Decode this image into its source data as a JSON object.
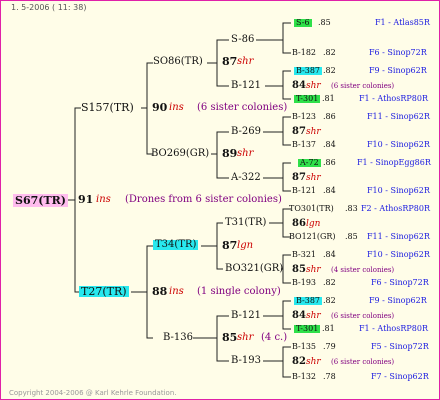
{
  "header": "1. 5-2006 ( 11: 38)",
  "footer": "Copyright 2004-2006 @ Karl Kehrle Foundation.",
  "root": {
    "id": "S67(TR)",
    "num": "91",
    "sym": "ins",
    "note": "(Drones from 6 sister colonies)"
  },
  "gen1": [
    {
      "id": "S157(TR)"
    },
    {
      "id": "T27(TR)"
    }
  ],
  "gen2": {
    "a": {
      "num": "90",
      "sym": "ins",
      "note": "(6 sister colonies)"
    },
    "b": {
      "num": "88",
      "sym": "ins",
      "note": "(1 single colony)"
    }
  },
  "gen3": [
    {
      "id": "SO86(TR)",
      "num": "87",
      "sym": "shr"
    },
    {
      "id": "BO269(GR)",
      "num": "89",
      "sym": "shr"
    },
    {
      "id": "T34(TR)",
      "num": "87",
      "sym": "lgn"
    },
    {
      "id": "B-136",
      "num": "85",
      "sym": "shr",
      "note": "(4 c.)"
    }
  ],
  "gen4": [
    {
      "id": "S-86",
      "num": "84",
      "sym": "shr",
      "note": "(6 sister colonies)"
    },
    {
      "id": "B-121"
    },
    {
      "id": "B-269",
      "num": "87",
      "sym": "shr"
    },
    {
      "id": "A-322"
    },
    {
      "id": "T31(TR)",
      "num": "86",
      "sym": "lgn"
    },
    {
      "id": "BO321(GR)",
      "num": "85",
      "sym": "shr",
      "note": "(4 sister colonies)"
    },
    {
      "id": "B-121",
      "num": "84",
      "sym": "shr",
      "note": "(6 sister colonies)"
    },
    {
      "id": "B-193",
      "num": "82",
      "sym": "shr",
      "note": "(6 sister colonies)"
    }
  ],
  "gen5": [
    {
      "id": "S-6",
      "val": ".85",
      "src": "F1 - Atlas85R"
    },
    {
      "id": "B-182",
      "val": ".82",
      "src": "F6 - Sinop72R"
    },
    {
      "id": "B-387",
      "val": ".82",
      "src": "F9 - Sinop62R"
    },
    {
      "id": "T-301",
      "val": ".81",
      "src": "F1 - AthosRP80R"
    },
    {
      "id": "B-123",
      "val": ".86",
      "src": "F11 - Sinop62R"
    },
    {
      "id": "B-137",
      "val": ".84",
      "src": "F10 - Sinop62R"
    },
    {
      "id": "A-72",
      "val": ".86",
      "src": "F1 - SinopEgg86R"
    },
    {
      "id": "B-121",
      "val": ".84",
      "src": "F10 - Sinop62R"
    },
    {
      "id": "TO301(TR)",
      "val": ".83",
      "src": "F2 - AthosRP80R"
    },
    {
      "id": "BO121(GR)",
      "val": ".85",
      "src": "F11 - Sinop62R"
    },
    {
      "id": "B-321",
      "val": ".84",
      "src": "F10 - Sinop62R"
    },
    {
      "id": "B-193",
      "val": ".82",
      "src": "F6 - Sinop72R"
    },
    {
      "id": "B-387",
      "val": ".82",
      "src": "F9 - Sinop62R"
    },
    {
      "id": "T-301",
      "val": ".81",
      "src": "F1 - AthosRP80R"
    },
    {
      "id": "B-135",
      "val": ".79",
      "src": "F5 - Sinop72R"
    },
    {
      "id": "B-132",
      "val": ".78",
      "src": "F7 - Sinop62R"
    }
  ]
}
